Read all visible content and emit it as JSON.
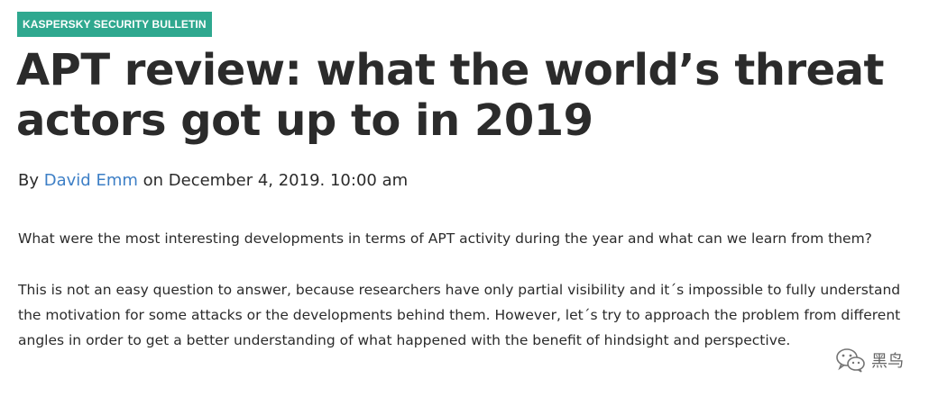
{
  "badge": {
    "label": "KASPERSKY SECURITY BULLETIN"
  },
  "article": {
    "title": "APT review: what the world’s threat actors got up to in 2019",
    "byline": {
      "by": "By",
      "author": "David Emm",
      "date_text": "on December 4, 2019. 10:00 am"
    },
    "paragraphs": [
      "What were the most interesting developments in terms of APT activity during the year and what can we learn from them?",
      "This is not an easy question to answer, because researchers have only partial visibility and it´s impossible to fully understand the motivation for some attacks or the developments behind them. However, let´s try to approach the problem from different angles in order to get a better understanding of what happened with the benefit of hindsight and perspective."
    ]
  },
  "watermark": {
    "icon": "wechat-icon",
    "text": "黑鸟"
  }
}
